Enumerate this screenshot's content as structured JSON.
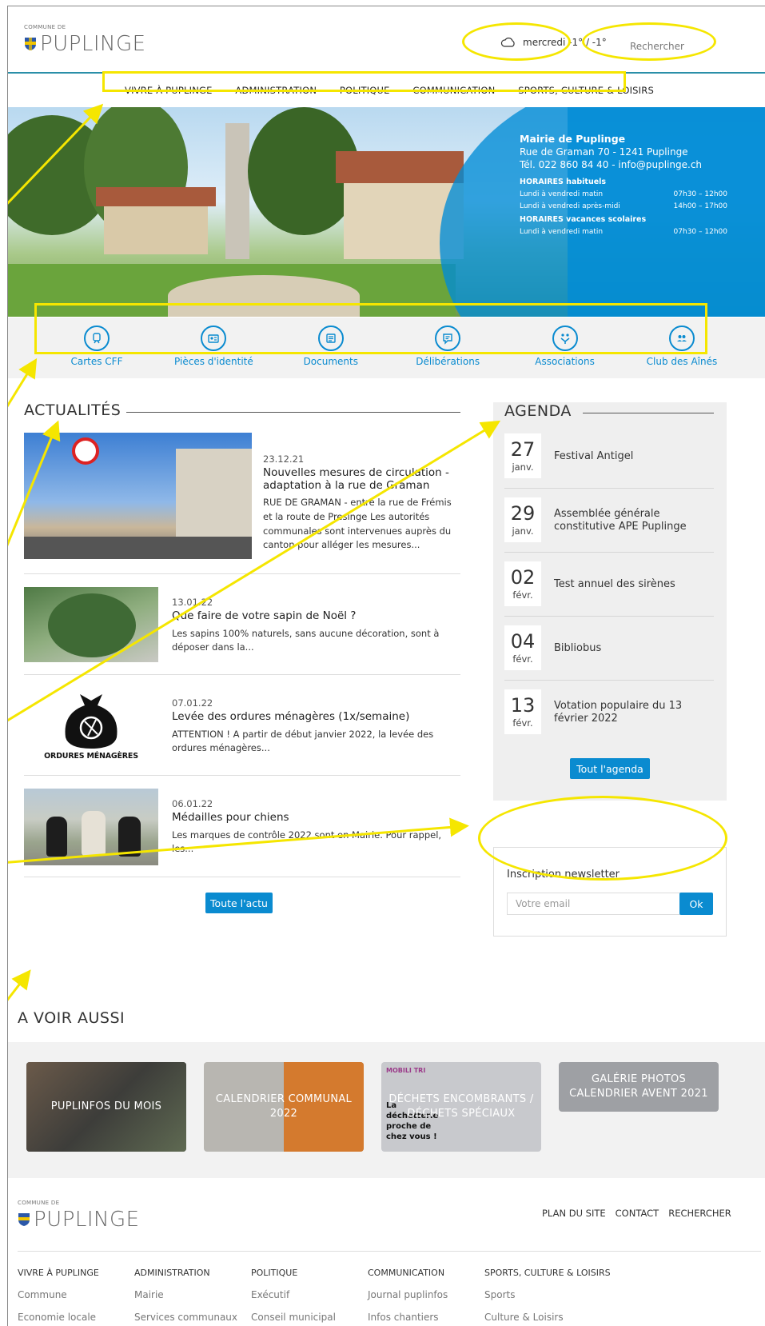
{
  "header": {
    "logo_commune": "COMMUNE DE",
    "logo_name": "PUPLINGE",
    "weather": "mercredi -1° / -1°",
    "search_placeholder": "Rechercher"
  },
  "nav": [
    "VIVRE À PUPLINGE",
    "ADMINISTRATION",
    "POLITIQUE",
    "COMMUNICATION",
    "SPORTS, CULTURE & LOISIRS"
  ],
  "hero": {
    "title": "Mairie de Puplinge",
    "address": "Rue de Graman 70 - 1241 Puplinge",
    "contact": "Tél. 022 860 84 40 - info@puplinge.ch",
    "hours_heading": "HORAIRES habituels",
    "hours": [
      {
        "label": "Lundi à vendredi matin",
        "time": "07h30 – 12h00"
      },
      {
        "label": "Lundi à vendredi après-midi",
        "time": "14h00 – 17h00"
      }
    ],
    "vac_heading": "HORAIRES vacances scolaires",
    "vac_hours": [
      {
        "label": "Lundi à vendredi matin",
        "time": "07h30 – 12h00"
      }
    ]
  },
  "quick_links": [
    {
      "label": "Cartes CFF",
      "icon": "train-icon"
    },
    {
      "label": "Pièces d'identité",
      "icon": "id-card-icon"
    },
    {
      "label": "Documents",
      "icon": "document-icon"
    },
    {
      "label": "Délibérations",
      "icon": "speech-bubble-icon"
    },
    {
      "label": "Associations",
      "icon": "handshake-icon"
    },
    {
      "label": "Club des Aînés",
      "icon": "people-icon"
    }
  ],
  "news": {
    "title": "ACTUALITÉS",
    "items": [
      {
        "date": "23.12.21",
        "title": "Nouvelles mesures de circulation - adaptation à la rue de Graman",
        "excerpt": "RUE DE GRAMAN - entre la rue de Frémis et la route de Presinge Les autorités communales sont intervenues auprès du canton pour alléger les mesures..."
      },
      {
        "date": "13.01.22",
        "title": "Que faire de votre sapin de Noël ?",
        "excerpt": "Les sapins 100% naturels, sans aucune décoration, sont à déposer dans la..."
      },
      {
        "date": "07.01.22",
        "title": "Levée des ordures ménagères (1x/semaine)",
        "excerpt": "ATTENTION ! A partir de début janvier 2022, la levée des ordures ménagères...",
        "image_text": "ORDURES MÉNAGÈRES"
      },
      {
        "date": "06.01.22",
        "title": "Médailles pour chiens",
        "excerpt": "Les marques de contrôle 2022 sont en Mairie. Pour rappel, les..."
      }
    ],
    "all_button": "Toute l'actu"
  },
  "agenda": {
    "title": "AGENDA",
    "items": [
      {
        "day": "27",
        "month": "janv.",
        "title": "Festival Antigel"
      },
      {
        "day": "29",
        "month": "janv.",
        "title": "Assemblée générale constitutive APE Puplinge"
      },
      {
        "day": "02",
        "month": "févr.",
        "title": "Test annuel des sirènes"
      },
      {
        "day": "04",
        "month": "févr.",
        "title": "Bibliobus"
      },
      {
        "day": "13",
        "month": "févr.",
        "title": "Votation populaire du 13 février 2022"
      }
    ],
    "all_button": "Tout l'agenda"
  },
  "newsletter": {
    "title": "Inscription newsletter",
    "placeholder": "Votre email",
    "button": "Ok"
  },
  "voir_aussi": {
    "title": "A VOIR AUSSI",
    "cards": [
      {
        "label": "PUPLINFOS DU MOIS"
      },
      {
        "label": "CALENDRIER COMMUNAL 2022"
      },
      {
        "label": "DÉCHETS ENCOMBRANTS / DÉCHETS SPÉCIAUX",
        "image_text_1": "MOBILI TRI",
        "image_text_2": "La déchetterie proche de chez vous !"
      },
      {
        "label": "GALÉRIE PHOTOS CALENDRIER AVENT 2021"
      }
    ]
  },
  "footer": {
    "links": [
      "PLAN DU SITE",
      "CONTACT",
      "RECHERCHER"
    ],
    "columns": [
      {
        "heading": "VIVRE À PUPLINGE",
        "links": [
          "Commune",
          "Economie locale"
        ]
      },
      {
        "heading": "ADMINISTRATION",
        "links": [
          "Mairie",
          "Services communaux"
        ]
      },
      {
        "heading": "POLITIQUE",
        "links": [
          "Exécutif",
          "Conseil municipal"
        ]
      },
      {
        "heading": "COMMUNICATION",
        "links": [
          "Journal puplinfos",
          "Infos chantiers"
        ]
      },
      {
        "heading": "SPORTS, CULTURE & LOISIRS",
        "links": [
          "Sports",
          "Culture & Loisirs"
        ]
      }
    ]
  },
  "colors": {
    "accent": "#0a8bd0",
    "annotation": "#f5e600",
    "header_line": "#2a8fa8"
  }
}
